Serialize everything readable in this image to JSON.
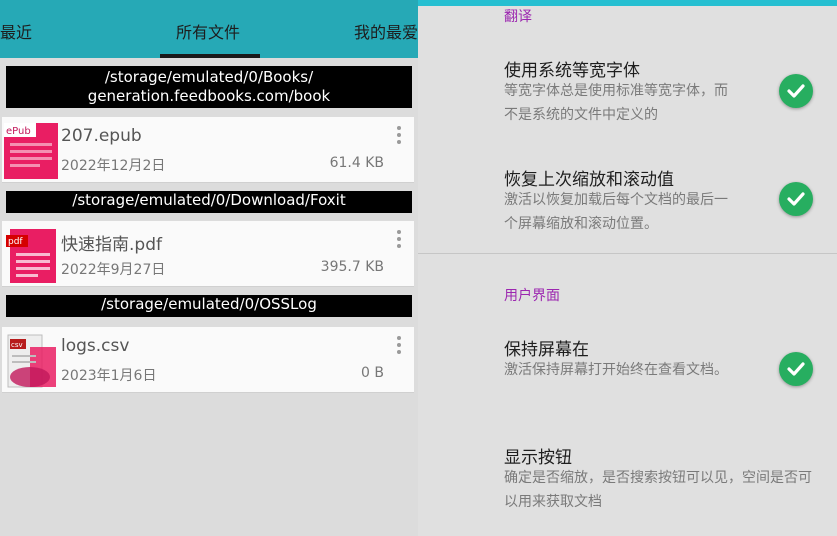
{
  "tabs": {
    "recent": "最近",
    "all_files": "所有文件",
    "favorites": "我的最爱"
  },
  "groups": [
    {
      "path_line1": "/storage/emulated/0/Books/",
      "path_line2": "generation.feedbooks.com/book",
      "file": {
        "name": "207.epub",
        "date": "2022年12月2日",
        "size": "61.4 KB",
        "badge": "ePub"
      }
    },
    {
      "path_line1": "/storage/emulated/0/Download/Foxit",
      "file": {
        "name": "快速指南.pdf",
        "date": "2022年9月27日",
        "size": "395.7 KB",
        "badge": "pdf"
      }
    },
    {
      "path_line1": "/storage/emulated/0/OSSLog",
      "file": {
        "name": "logs.csv",
        "date": "2023年1月6日",
        "size": "0 B",
        "badge": "csv"
      }
    }
  ],
  "settings": {
    "translate_header": "翻译",
    "ui_header": "用户界面",
    "items": [
      {
        "title": "使用系统等宽字体",
        "summary": "等宽字体总是使用标准等宽字体，而不是系统的文件中定义的",
        "checked": true
      },
      {
        "title": "恢复上次缩放和滚动值",
        "summary": "激活以恢复加载后每个文档的最后一个屏幕缩放和滚动位置。",
        "checked": true
      },
      {
        "title": "保持屏幕在",
        "summary": "激活保持屏幕打开始终在查看文档。",
        "checked": true
      },
      {
        "title": "显示按钮",
        "summary": "确定是否缩放，是否搜索按钮可以见，空间是否可以用来获取文档"
      }
    ]
  },
  "colors": {
    "tab_bar": "#26a9b6",
    "accent_header": "#9c27b0",
    "check_on": "#27ae60",
    "thumb_pink": "#e91e63"
  }
}
